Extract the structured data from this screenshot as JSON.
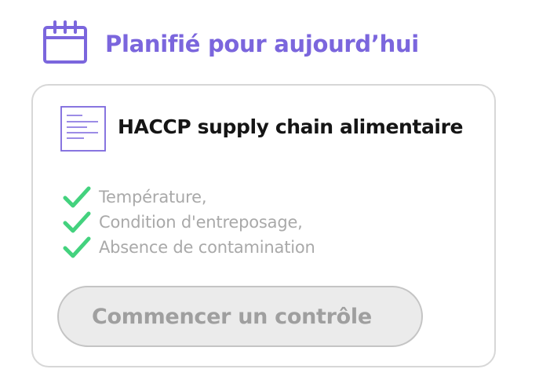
{
  "header": {
    "icon": "calendar-icon",
    "title": "Planifié pour aujourd’hui",
    "accent_color": "#7b66dd"
  },
  "card": {
    "icon": "document-icon",
    "title": "HACCP supply chain alimentaire",
    "checklist": [
      {
        "icon": "checkmark-icon",
        "label": "Température,"
      },
      {
        "icon": "checkmark-icon",
        "label": "Condition d'entreposage,"
      },
      {
        "icon": "checkmark-icon",
        "label": "Absence de contamination"
      }
    ],
    "check_color": "#43d27e",
    "start_button_label": "Commencer un contrôle"
  }
}
